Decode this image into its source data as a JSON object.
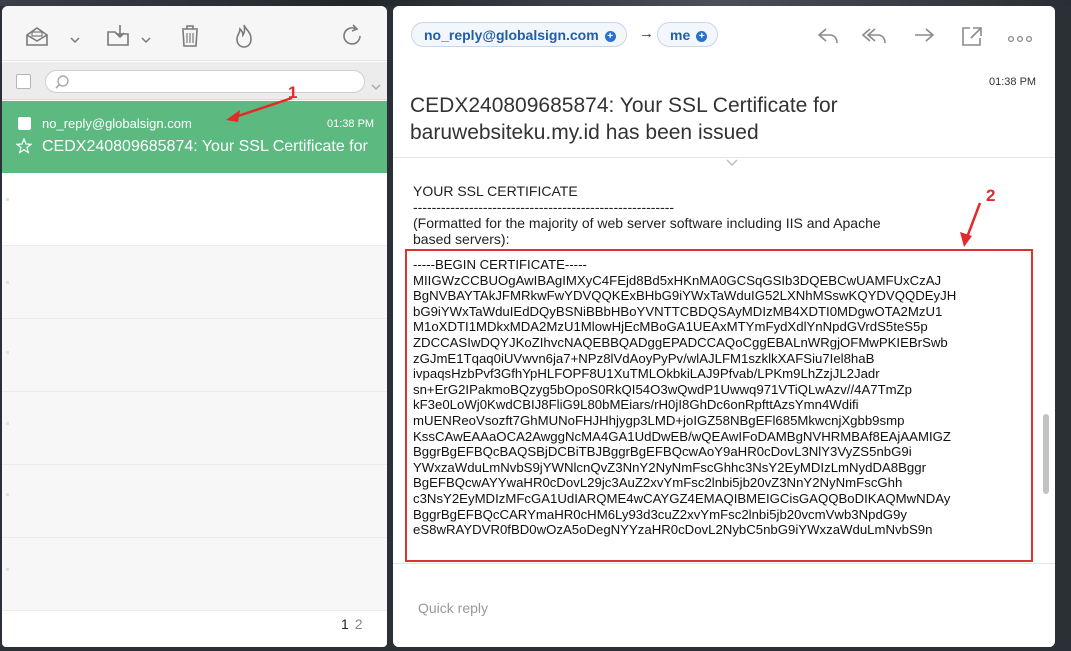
{
  "message_list": {
    "selected": {
      "sender": "no_reply@globalsign.com",
      "time": "01:38 PM",
      "subject": "CEDX240809685874: Your SSL Certificate for baruwebsiteku.my.id has been issued"
    },
    "pagination": [
      "1",
      "2"
    ]
  },
  "search": {
    "placeholder": ""
  },
  "detail": {
    "from": "no_reply@globalsign.com",
    "arrow": "→",
    "to": "me",
    "time": "01:38 PM",
    "subject": "CEDX240809685874: Your SSL Certificate for baruwebsiteku.my.id has been issued",
    "body": {
      "heading": "YOUR SSL CERTIFICATE",
      "separator": "--------------------------------------------------------",
      "note_line1": "(Formatted for the majority of web server software including IIS and Apache",
      "note_line2": "based servers):",
      "certificate_lines": [
        "-----BEGIN CERTIFICATE-----",
        "MIIGWzCCBUOgAwIBAgIMXyC4FEjd8Bd5xHKnMA0GCSqGSIb3DQEBCwUAMFUxCzAJ",
        "BgNVBAYTAkJFMRkwFwYDVQQKExBHbG9iYWxTaWduIG52LXNhMSswKQYDVQQDEyJH",
        "bG9iYWxTaWduIEdDQyBSNiBBbHBoYVNTTCBDQSAyMDIzMB4XDTI0MDgwOTA2MzU1",
        "M1oXDTI1MDkxMDA2MzU1MlowHjEcMBoGA1UEAxMTYmFydXdlYnNpdGVrdS5teS5p",
        "ZDCCASIwDQYJKoZIhvcNAQEBBQADggEPADCCAQoCggEBALnWRgjOFMwPKIEBrSwb",
        "zGJmE1Tqaq0iUVwvn6ja7+NPz8lVdAoyPyPv/wlAJLFM1szklkXAFSiu7Iel8haB",
        "ivpaqsHzbPvf3GfhYpHLFOPF8U1XuTMLOkbkiLAJ9Pfvab/LPKm9LhZzjJL2Jadr",
        "sn+ErG2IPakmoBQzyg5bOpoS0RkQI54O3wQwdP1Uwwq971VTiQLwAzv//4A7TmZp",
        "kF3e0LoWj0KwdCBIJ8FliG9L80bMEiars/rH0jI8GhDc6onRpfttAzsYmn4Wdifi",
        "mUENReoVsozft7GhMUNoFHJHhjygp3LMD+joIGZ58NBgEFl685MkwcnjXgbb9smp",
        "KssCAwEAAaOCA2AwggNcMA4GA1UdDwEB/wQEAwIFoDAMBgNVHRMBAf8EAjAAMIGZ",
        "BggrBgEFBQcBAQSBjDCBiTBJBggrBgEFBQcwAoY9aHR0cDovL3NlY3VyZS5nbG9i",
        "YWxzaWduLmNvbS9jYWNlcnQvZ3NnY2NyNmFscGhhc3NsY2EyMDIzLmNydDA8Bggr",
        "BgEFBQcwAYYwaHR0cDovL29jc3AuZ2xvYmFsc2lnbi5jb20vZ3NnY2NyNmFscGhh",
        "c3NsY2EyMDIzMFcGA1UdIARQME4wCAYGZ4EMAQIBMEIGCisGAQQBoDIKAQMwNDAy",
        "BggrBgEFBQcCARYmaHR0cHM6Ly93d3cuZ2xvYmFsc2lnbi5jb20vcmVwb3NpdG9y",
        "eS8wRAYDVR0fBD0wOzA5oDegNYYzaHR0cDovL2NybC5nbG9iYWxzaWduLmNvbS9n"
      ]
    }
  },
  "quick_reply": {
    "placeholder": "Quick reply"
  },
  "annotations": {
    "label_1": "1",
    "label_2": "2"
  },
  "colors": {
    "selected_row": "#5cba80",
    "pill_text": "#1f5fa8",
    "annotation": "#e22a2a"
  },
  "icons": {
    "left_toolbar": [
      "archive-icon",
      "move-to-folder-icon",
      "trash-icon",
      "burn-icon",
      "refresh-icon"
    ],
    "right_toolbar": [
      "reply-icon",
      "reply-all-icon",
      "forward-icon",
      "open-in-window-icon",
      "more-icon"
    ]
  }
}
